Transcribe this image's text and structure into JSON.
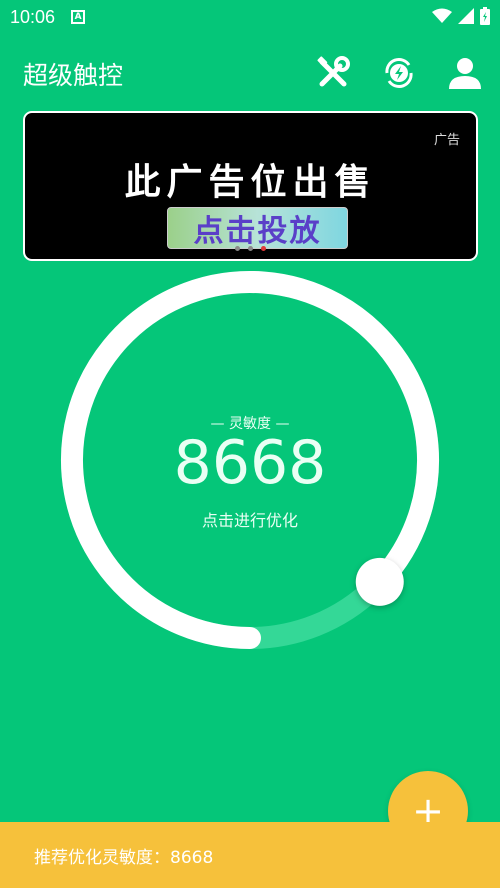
{
  "status_bar": {
    "time": "10:06",
    "app_icon_letter": "A"
  },
  "app_bar": {
    "title": "超级触控",
    "icons": [
      "tools-icon",
      "speed-boost-icon",
      "profile-icon"
    ]
  },
  "ad": {
    "tag": "广告",
    "headline": "此广告位出售",
    "cta": "点击投放",
    "carousel_pages": 3,
    "active_page": 3
  },
  "gauge": {
    "label": "— 灵敏度 —",
    "value": "8668",
    "action": "点击进行优化",
    "progress": 0.87
  },
  "fab": {
    "symbol": "+"
  },
  "bottom_bar": {
    "text": "推荐优化灵敏度：8668"
  },
  "colors": {
    "background": "#05C679",
    "accent": "#F6C13B",
    "ad_active_dot": "#E23A3A"
  }
}
